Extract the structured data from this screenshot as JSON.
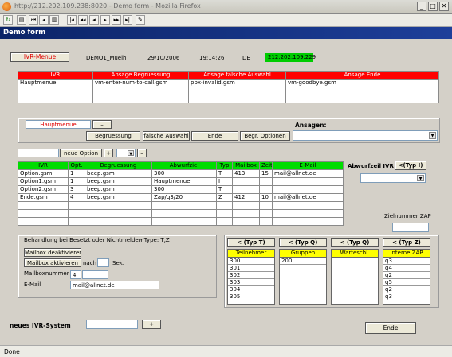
{
  "window": {
    "title": "http://212.202.109.238:8020 - Demo form - Mozilla Firefox",
    "app_title": "Demo form",
    "status": "Done"
  },
  "header": {
    "menu_label": "IVR-Menue",
    "name": "DEMO1_Muelh",
    "date": "29/10/2006",
    "time": "19:14:26",
    "lang": "DE",
    "ip": "212.202.109.229"
  },
  "ivr_table": {
    "columns": [
      "IVR",
      "Ansage Begruessung",
      "Ansage falsche Auswahl",
      "Ansage Ende"
    ],
    "rows": [
      [
        "Hauptmenue",
        "vm-enter-num-to-call.gsm",
        "pbx-invalid.gsm",
        "vm-goodbye.gsm"
      ],
      [
        "",
        "",
        "",
        ""
      ],
      [
        "",
        "",
        "",
        ""
      ]
    ]
  },
  "controls": {
    "menu_value": "Hauptmenue",
    "minus": "–",
    "begruessung": "Begruessung",
    "falsche": "falsche Auswahl",
    "ende": "Ende",
    "begr_optionen": "Begr. Optionen",
    "ansagen_label": "Ansagen:",
    "neue_option": "neue Option",
    "plus": "+"
  },
  "options_table": {
    "columns": [
      "IVR",
      "Opt.",
      "Begruessung",
      "Abwurfziel",
      "Typ",
      "Mailbox",
      "Zeit",
      "E-Mail"
    ],
    "rows": [
      [
        "Option.gsm",
        "1",
        "beep.gsm",
        "300",
        "T",
        "413",
        "15",
        "mail@allnet.de"
      ],
      [
        "Option1.gsm",
        "1",
        "beep.gsm",
        "Hauptmenue",
        "I",
        "",
        "",
        ""
      ],
      [
        "Option2.gsm",
        "3",
        "beep.gsm",
        "300",
        "T",
        "",
        "",
        ""
      ],
      [
        "Ende.gsm",
        "4",
        "beep.gsm",
        "Zap/q3/20",
        "Z",
        "412",
        "10",
        "mail@allnet.de"
      ],
      [
        "",
        "",
        "",
        "",
        "",
        "",
        "",
        ""
      ],
      [
        "",
        "",
        "",
        "",
        "",
        "",
        "",
        ""
      ],
      [
        "",
        "",
        "",
        "",
        "",
        "",
        "",
        ""
      ]
    ]
  },
  "abwurf": {
    "label": "Abwurfzeil IVR",
    "typ_button": "<(Typ I)",
    "zielnummer_label": "Zielnummer ZAP"
  },
  "busy": {
    "title": "Behandlung bei Besetzt oder Nichtmelden",
    "type_note": "- Type: T,Z",
    "mailbox_deaktivieren": "Mailbox deaktivieren",
    "mailbox_aktivieren": "Mailbox aktivieren",
    "nach": "nach",
    "sek": "Sek.",
    "mailboxnummer_label": "Mailboxnummer",
    "mailboxnummer": "4",
    "email_label": "E-Mail",
    "email": "mail@allnet.de"
  },
  "pickers": [
    {
      "button": "< (Typ T)",
      "header": "Teilnehmer",
      "items": [
        "300",
        "301",
        "302",
        "303",
        "304",
        "305"
      ]
    },
    {
      "button": "< (Typ Q)",
      "header": "Gruppen",
      "items": [
        "200"
      ]
    },
    {
      "button": "< (Typ Q)",
      "header": "Warteschl.",
      "items": []
    },
    {
      "button": "< (Typ Z)",
      "header": "interne ZAP",
      "items": [
        "q3",
        "q4",
        "q2",
        "q5",
        "q2",
        "q3"
      ]
    }
  ],
  "footer": {
    "neues_label": "neues IVR-System",
    "plus": "+",
    "ende": "Ende"
  },
  "colors": {
    "red": "#ff0000",
    "green": "#00dd00",
    "yellow": "#ffff00",
    "title_blue": "#0b2467"
  }
}
